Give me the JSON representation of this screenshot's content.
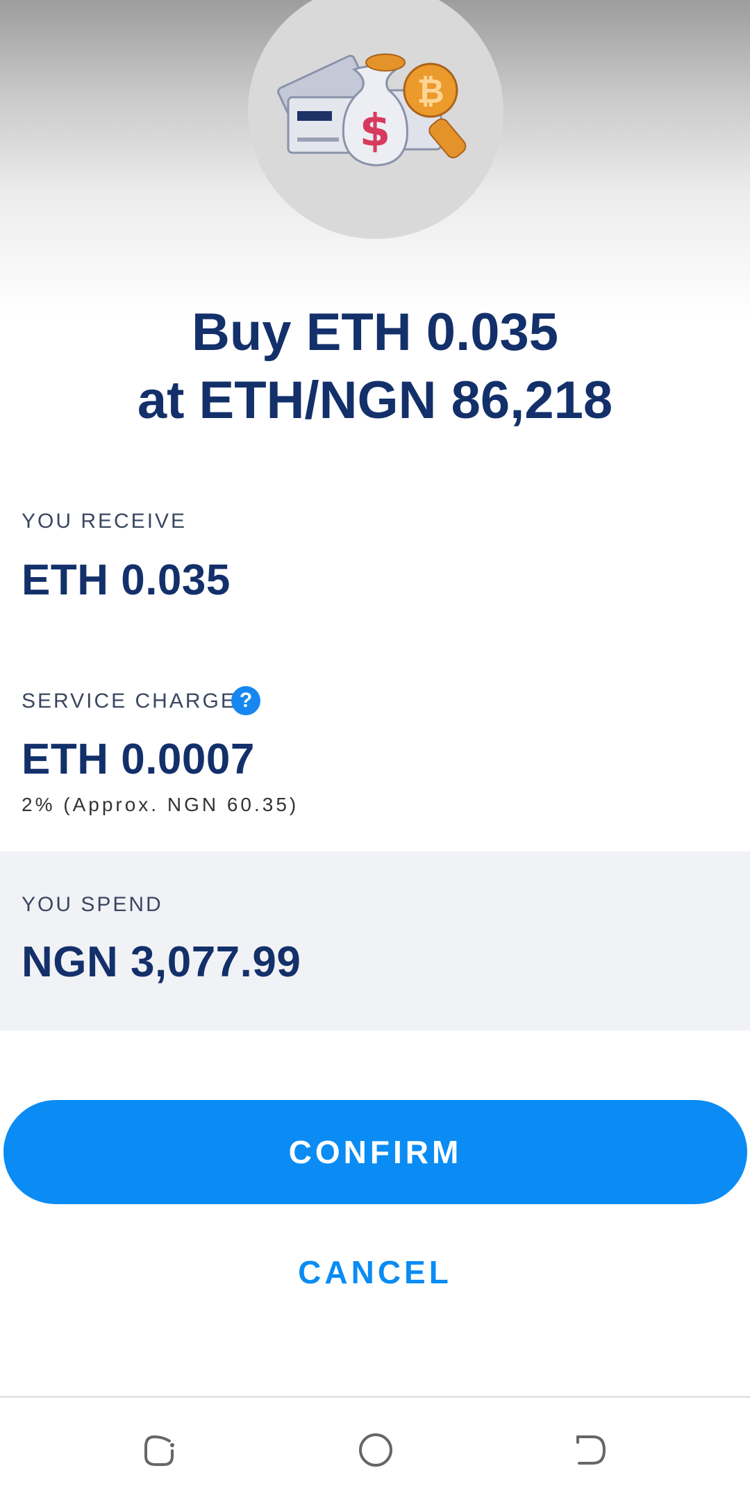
{
  "header": {
    "title_line1": "Buy ETH 0.035",
    "title_line2": "at ETH/NGN 86,218"
  },
  "receive": {
    "label": "YOU RECEIVE",
    "value": "ETH 0.035"
  },
  "service_charge": {
    "label": "SERVICE CHARGE",
    "help_icon": "?",
    "value": "ETH 0.0007",
    "note": "2% (Approx. NGN 60.35)"
  },
  "spend": {
    "label": "YOU SPEND",
    "value": "NGN 3,077.99"
  },
  "actions": {
    "confirm_label": "CONFIRM",
    "cancel_label": "CANCEL"
  },
  "nav": {
    "recents_icon": "recent-apps-icon",
    "home_icon": "home-icon",
    "back_icon": "back-icon"
  },
  "colors": {
    "accent": "#0a8cf4",
    "title": "#13306a",
    "spend_background": "#f1f2f6"
  }
}
